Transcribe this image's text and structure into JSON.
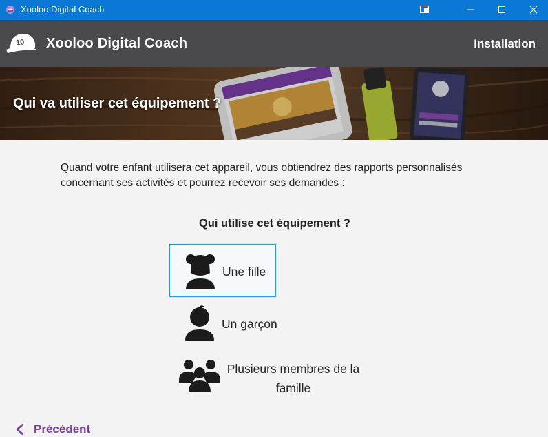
{
  "window": {
    "title": "Xooloo Digital Coach"
  },
  "header": {
    "app_name": "Xooloo Digital Coach",
    "step": "Installation"
  },
  "banner": {
    "heading": "Qui va utiliser cet équipement ?"
  },
  "content": {
    "intro": "Quand votre enfant utilisera cet appareil, vous obtiendrez des rapports personnalisés concernant ses activités et pourrez recevoir ses demandes :",
    "question": "Qui utilise cet équipement ?",
    "options": [
      {
        "label": "Une fille",
        "icon": "girl-icon",
        "selected": true
      },
      {
        "label": "Un garçon",
        "icon": "boy-icon",
        "selected": false
      },
      {
        "label": "Plusieurs membres de la famille",
        "icon": "family-icon",
        "selected": false
      }
    ]
  },
  "footer": {
    "previous_label": "Précédent"
  },
  "colors": {
    "titlebar": "#0a78d4",
    "appbar": "#4a4a4c",
    "accent": "#7c3aa8",
    "selection": "#2b9fd6"
  }
}
